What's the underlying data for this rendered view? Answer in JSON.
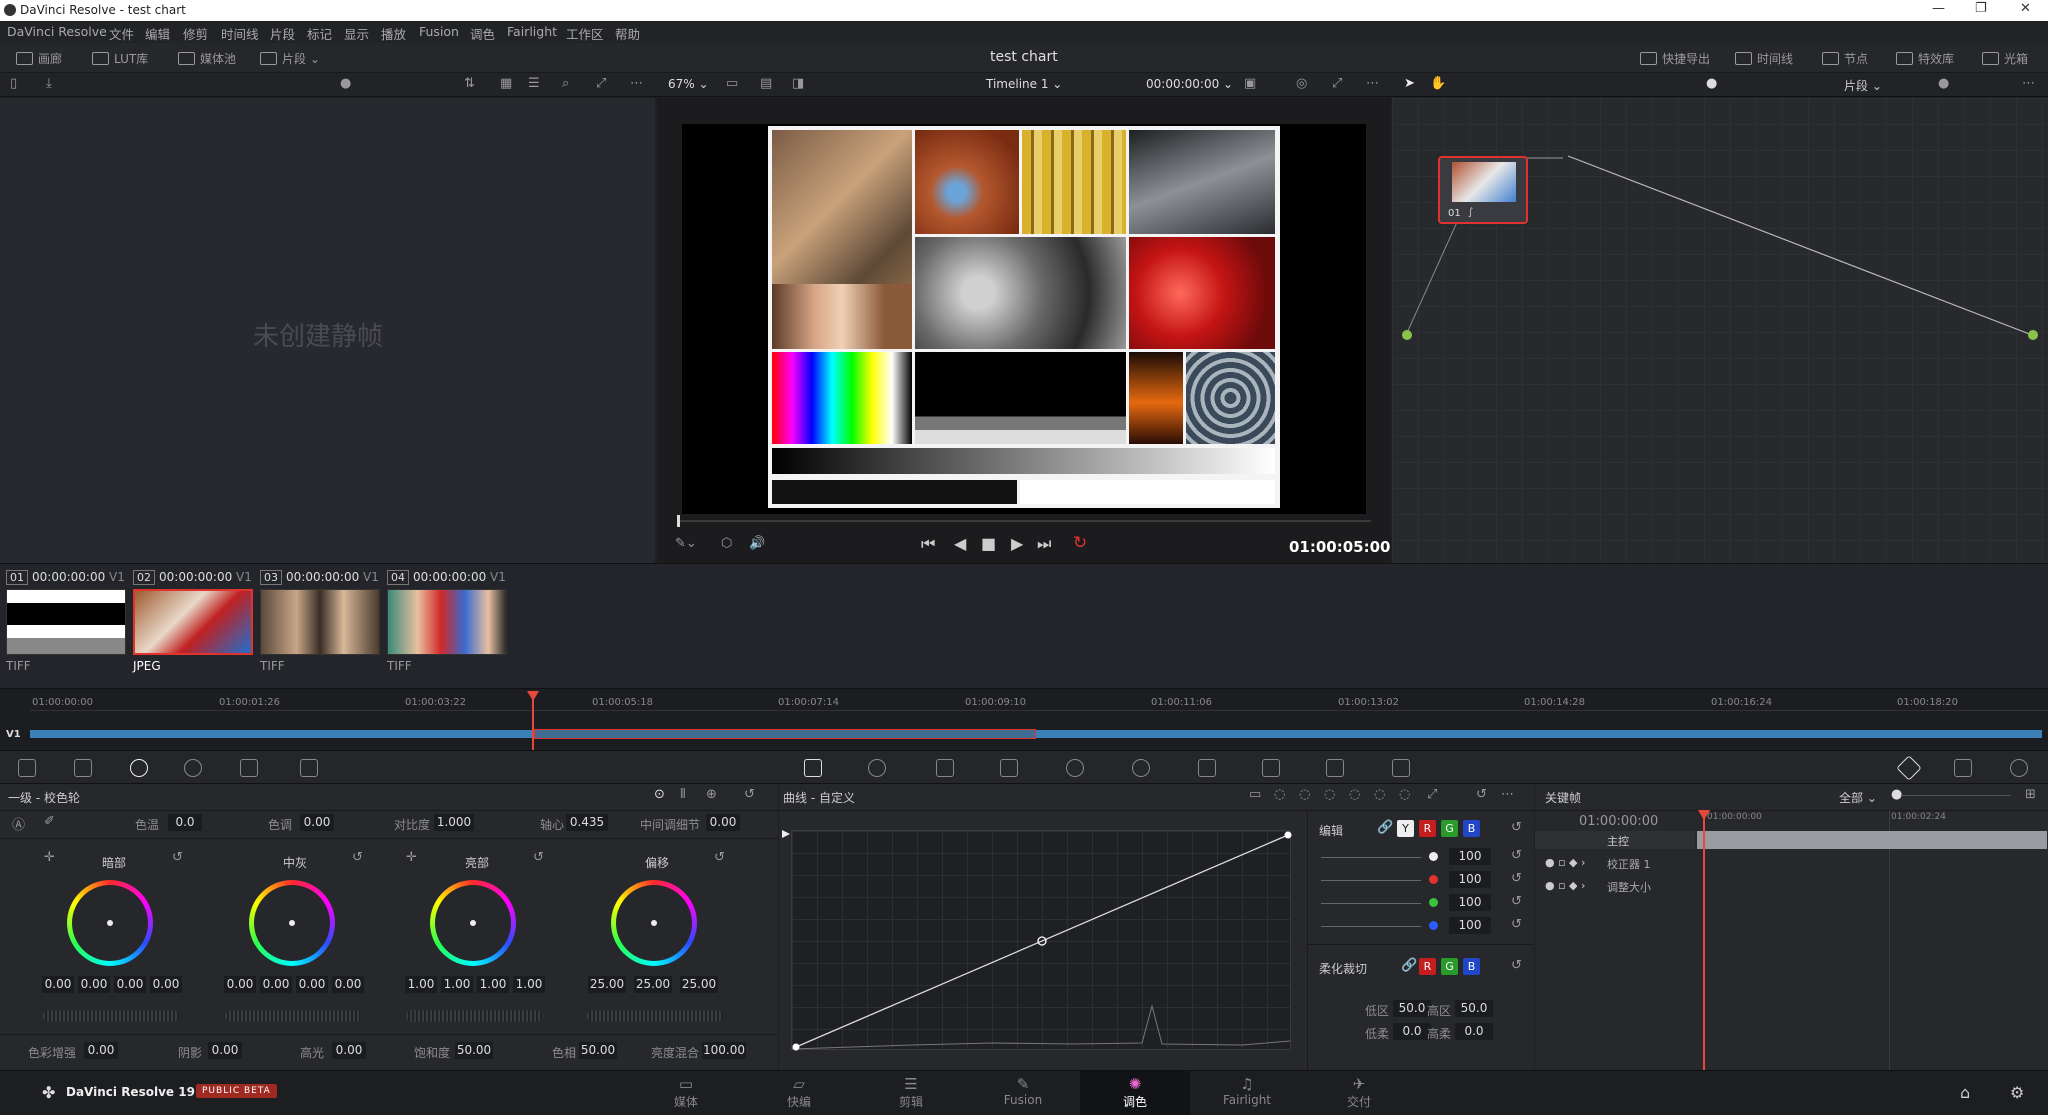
{
  "window": {
    "title": "DaVinci Resolve - test chart",
    "controls": [
      "—",
      "❐",
      "✕"
    ]
  },
  "menu": [
    "DaVinci Resolve",
    "文件",
    "编辑",
    "修剪",
    "时间线",
    "片段",
    "标记",
    "显示",
    "播放",
    "Fusion",
    "调色",
    "Fairlight",
    "工作区",
    "帮助"
  ],
  "toolbar": {
    "left": [
      "画廊",
      "LUT库",
      "媒体池",
      "片段"
    ],
    "project_title": "test chart",
    "right": [
      "快捷导出",
      "时间线",
      "节点",
      "特效库",
      "光箱"
    ]
  },
  "subbar": {
    "zoom": "67%",
    "timeline_name": "Timeline 1",
    "timecode": "00:00:00:00",
    "node_mode": "片段"
  },
  "gallery": {
    "empty_text": "未创建静帧"
  },
  "viewer": {
    "current_timecode": "01:00:05:00"
  },
  "clips": [
    {
      "num": "01",
      "timecode": "00:00:00:00",
      "track": "V1",
      "format": "TIFF"
    },
    {
      "num": "02",
      "timecode": "00:00:00:00",
      "track": "V1",
      "format": "JPEG"
    },
    {
      "num": "03",
      "timecode": "00:00:00:00",
      "track": "V1",
      "format": "TIFF"
    },
    {
      "num": "04",
      "timecode": "00:00:00:00",
      "track": "V1",
      "format": "TIFF"
    }
  ],
  "node": {
    "label": "01"
  },
  "timeline": {
    "ticks": [
      "01:00:00:00",
      "01:00:01:26",
      "01:00:03:22",
      "01:00:05:18",
      "01:00:07:14",
      "01:00:09:10",
      "01:00:11:06",
      "01:00:13:02",
      "01:00:14:28",
      "01:00:16:24",
      "01:00:18:20"
    ],
    "track": "V1"
  },
  "primaries": {
    "title": "一级 - 校色轮",
    "top": [
      {
        "label": "色温",
        "value": "0.0"
      },
      {
        "label": "色调",
        "value": "0.00"
      },
      {
        "label": "对比度",
        "value": "1.000"
      },
      {
        "label": "轴心",
        "value": "0.435"
      },
      {
        "label": "中间调细节",
        "value": "0.00"
      }
    ],
    "wheels": [
      {
        "label": "暗部",
        "values": [
          "0.00",
          "0.00",
          "0.00",
          "0.00"
        ]
      },
      {
        "label": "中灰",
        "values": [
          "0.00",
          "0.00",
          "0.00",
          "0.00"
        ]
      },
      {
        "label": "亮部",
        "values": [
          "1.00",
          "1.00",
          "1.00",
          "1.00"
        ]
      },
      {
        "label": "偏移",
        "values": [
          "25.00",
          "25.00",
          "25.00"
        ]
      }
    ],
    "bottom": [
      {
        "label": "色彩增强",
        "value": "0.00"
      },
      {
        "label": "阴影",
        "value": "0.00"
      },
      {
        "label": "高光",
        "value": "0.00"
      },
      {
        "label": "饱和度",
        "value": "50.00"
      },
      {
        "label": "色相",
        "value": "50.00"
      },
      {
        "label": "亮度混合",
        "value": "100.00"
      }
    ]
  },
  "curves": {
    "title": "曲线 - 自定义",
    "edit_label": "编辑",
    "channels": [
      "Y",
      "R",
      "G",
      "B"
    ],
    "intensities": [
      "100",
      "100",
      "100",
      "100"
    ],
    "soft_clip_label": "柔化裁切",
    "soft": [
      {
        "label": "低区",
        "value": "50.0"
      },
      {
        "label": "高区",
        "value": "50.0"
      },
      {
        "label": "低柔",
        "value": "0.0"
      },
      {
        "label": "高柔",
        "value": "0.0"
      }
    ]
  },
  "keyframes": {
    "title": "关键帧",
    "filter": "全部",
    "timecode": "01:00:00:00",
    "ruler": [
      "01:00:00:00",
      "01:00:02:24"
    ],
    "rows": [
      "主控",
      "校正器 1",
      "调整大小"
    ]
  },
  "app": {
    "name": "DaVinci Resolve 19",
    "badge": "PUBLIC BETA"
  },
  "pages": [
    {
      "label": "媒体",
      "glyph": "▭"
    },
    {
      "label": "快编",
      "glyph": "▱"
    },
    {
      "label": "剪辑",
      "glyph": "☰"
    },
    {
      "label": "Fusion",
      "glyph": "✎"
    },
    {
      "label": "调色",
      "glyph": "✺"
    },
    {
      "label": "Fairlight",
      "glyph": "♫"
    },
    {
      "label": "交付",
      "glyph": "✈"
    }
  ],
  "colors": {
    "accent_red": "#e0332e",
    "track_blue": "#3a7fb8",
    "playhead": "#e8483c"
  }
}
